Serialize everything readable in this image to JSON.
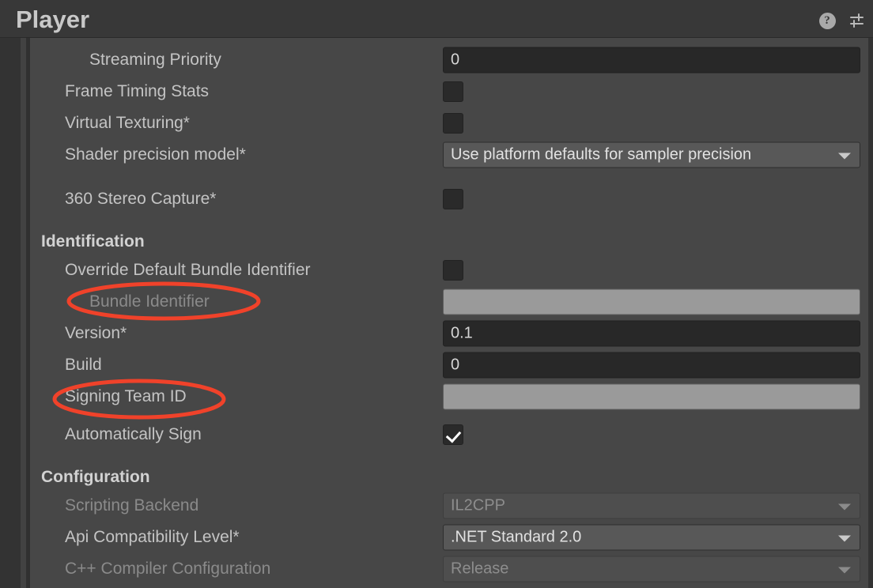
{
  "window": {
    "title": "Player",
    "help_icon": "help-circle-icon",
    "help_glyph": "?",
    "settings_icon": "sliders-settings-icon"
  },
  "colors": {
    "panel_bg": "#474747",
    "titlebar_bg": "#383838",
    "field_bg": "#282828",
    "dropdown_bg": "#585858",
    "gray_field": "#9a9a9a",
    "text": "#c4c4c4",
    "text_dim": "#8a8a8a",
    "annotation": "#f0422a"
  },
  "rows": [
    {
      "id": "streaming-priority",
      "label": "Streaming Priority",
      "indent": 2,
      "dim": false,
      "control": "text",
      "value": "0"
    },
    {
      "id": "frame-timing-stats",
      "label": "Frame Timing Stats",
      "indent": 1,
      "dim": false,
      "control": "checkbox",
      "checked": false
    },
    {
      "id": "virtual-texturing",
      "label": "Virtual Texturing*",
      "indent": 1,
      "dim": false,
      "control": "checkbox",
      "checked": false
    },
    {
      "id": "shader-precision-model",
      "label": "Shader precision model*",
      "indent": 1,
      "dim": false,
      "control": "dropdown",
      "value": "Use platform defaults for sampler precision"
    },
    {
      "id": "360-stereo-capture",
      "label": "360 Stereo Capture*",
      "indent": 1,
      "dim": false,
      "control": "checkbox",
      "checked": false
    },
    {
      "id": "identification-section",
      "label": "Identification",
      "indent": 0,
      "dim": false,
      "control": "none"
    },
    {
      "id": "override-default-bundle-identifier",
      "label": "Override Default Bundle Identifier",
      "indent": 1,
      "dim": false,
      "control": "checkbox",
      "checked": false
    },
    {
      "id": "bundle-identifier",
      "label": "Bundle Identifier",
      "indent": 2,
      "dim": true,
      "control": "text-gray",
      "value": ""
    },
    {
      "id": "version",
      "label": "Version*",
      "indent": 1,
      "dim": false,
      "control": "text",
      "value": "0.1"
    },
    {
      "id": "build",
      "label": "Build",
      "indent": 1,
      "dim": false,
      "control": "text",
      "value": "0"
    },
    {
      "id": "signing-team-id",
      "label": "Signing Team ID",
      "indent": 1,
      "dim": false,
      "control": "text-gray",
      "value": ""
    },
    {
      "id": "automatically-sign",
      "label": "Automatically Sign",
      "indent": 1,
      "dim": false,
      "control": "checkbox",
      "checked": true
    },
    {
      "id": "configuration-section",
      "label": "Configuration",
      "indent": 0,
      "dim": false,
      "control": "none"
    },
    {
      "id": "scripting-backend",
      "label": "Scripting Backend",
      "indent": 1,
      "dim": true,
      "control": "dropdown-dim",
      "value": "IL2CPP"
    },
    {
      "id": "api-compatibility-level",
      "label": "Api Compatibility Level*",
      "indent": 1,
      "dim": false,
      "control": "dropdown",
      "value": ".NET Standard 2.0"
    },
    {
      "id": "cpp-compiler-configuration",
      "label": "C++ Compiler Configuration",
      "indent": 1,
      "dim": true,
      "control": "dropdown-dim",
      "value": "Release"
    }
  ],
  "annotations": [
    {
      "id": "annotation-bundle-identifier",
      "target": "bundle-identifier",
      "shape": "ellipse"
    },
    {
      "id": "annotation-signing-team-id",
      "target": "signing-team-id",
      "shape": "ellipse"
    }
  ]
}
